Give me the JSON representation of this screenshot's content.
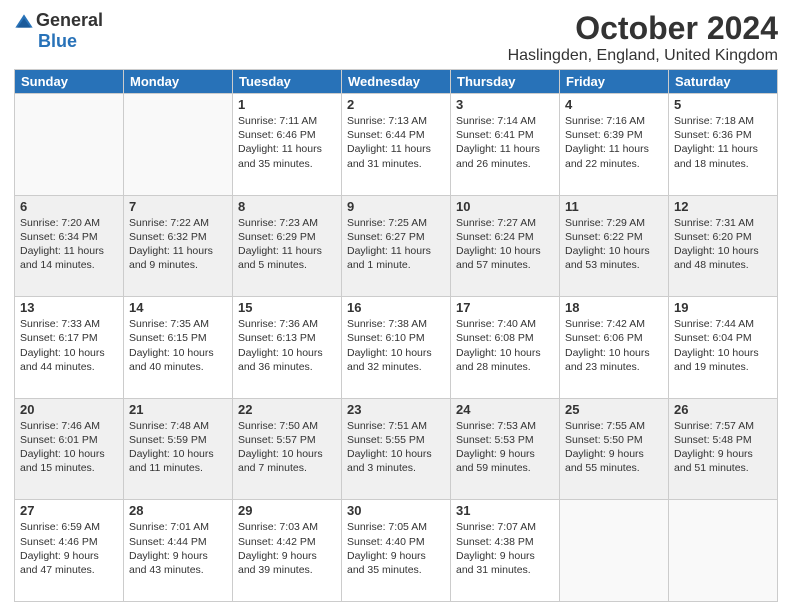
{
  "header": {
    "logo": {
      "general": "General",
      "blue": "Blue",
      "logo_symbol": "▶"
    },
    "title": "October 2024",
    "subtitle": "Haslingden, England, United Kingdom"
  },
  "days_of_week": [
    "Sunday",
    "Monday",
    "Tuesday",
    "Wednesday",
    "Thursday",
    "Friday",
    "Saturday"
  ],
  "weeks": [
    [
      {
        "day": "",
        "info": ""
      },
      {
        "day": "",
        "info": ""
      },
      {
        "day": "1",
        "info": "Sunrise: 7:11 AM\nSunset: 6:46 PM\nDaylight: 11 hours\nand 35 minutes."
      },
      {
        "day": "2",
        "info": "Sunrise: 7:13 AM\nSunset: 6:44 PM\nDaylight: 11 hours\nand 31 minutes."
      },
      {
        "day": "3",
        "info": "Sunrise: 7:14 AM\nSunset: 6:41 PM\nDaylight: 11 hours\nand 26 minutes."
      },
      {
        "day": "4",
        "info": "Sunrise: 7:16 AM\nSunset: 6:39 PM\nDaylight: 11 hours\nand 22 minutes."
      },
      {
        "day": "5",
        "info": "Sunrise: 7:18 AM\nSunset: 6:36 PM\nDaylight: 11 hours\nand 18 minutes."
      }
    ],
    [
      {
        "day": "6",
        "info": "Sunrise: 7:20 AM\nSunset: 6:34 PM\nDaylight: 11 hours\nand 14 minutes."
      },
      {
        "day": "7",
        "info": "Sunrise: 7:22 AM\nSunset: 6:32 PM\nDaylight: 11 hours\nand 9 minutes."
      },
      {
        "day": "8",
        "info": "Sunrise: 7:23 AM\nSunset: 6:29 PM\nDaylight: 11 hours\nand 5 minutes."
      },
      {
        "day": "9",
        "info": "Sunrise: 7:25 AM\nSunset: 6:27 PM\nDaylight: 11 hours\nand 1 minute."
      },
      {
        "day": "10",
        "info": "Sunrise: 7:27 AM\nSunset: 6:24 PM\nDaylight: 10 hours\nand 57 minutes."
      },
      {
        "day": "11",
        "info": "Sunrise: 7:29 AM\nSunset: 6:22 PM\nDaylight: 10 hours\nand 53 minutes."
      },
      {
        "day": "12",
        "info": "Sunrise: 7:31 AM\nSunset: 6:20 PM\nDaylight: 10 hours\nand 48 minutes."
      }
    ],
    [
      {
        "day": "13",
        "info": "Sunrise: 7:33 AM\nSunset: 6:17 PM\nDaylight: 10 hours\nand 44 minutes."
      },
      {
        "day": "14",
        "info": "Sunrise: 7:35 AM\nSunset: 6:15 PM\nDaylight: 10 hours\nand 40 minutes."
      },
      {
        "day": "15",
        "info": "Sunrise: 7:36 AM\nSunset: 6:13 PM\nDaylight: 10 hours\nand 36 minutes."
      },
      {
        "day": "16",
        "info": "Sunrise: 7:38 AM\nSunset: 6:10 PM\nDaylight: 10 hours\nand 32 minutes."
      },
      {
        "day": "17",
        "info": "Sunrise: 7:40 AM\nSunset: 6:08 PM\nDaylight: 10 hours\nand 28 minutes."
      },
      {
        "day": "18",
        "info": "Sunrise: 7:42 AM\nSunset: 6:06 PM\nDaylight: 10 hours\nand 23 minutes."
      },
      {
        "day": "19",
        "info": "Sunrise: 7:44 AM\nSunset: 6:04 PM\nDaylight: 10 hours\nand 19 minutes."
      }
    ],
    [
      {
        "day": "20",
        "info": "Sunrise: 7:46 AM\nSunset: 6:01 PM\nDaylight: 10 hours\nand 15 minutes."
      },
      {
        "day": "21",
        "info": "Sunrise: 7:48 AM\nSunset: 5:59 PM\nDaylight: 10 hours\nand 11 minutes."
      },
      {
        "day": "22",
        "info": "Sunrise: 7:50 AM\nSunset: 5:57 PM\nDaylight: 10 hours\nand 7 minutes."
      },
      {
        "day": "23",
        "info": "Sunrise: 7:51 AM\nSunset: 5:55 PM\nDaylight: 10 hours\nand 3 minutes."
      },
      {
        "day": "24",
        "info": "Sunrise: 7:53 AM\nSunset: 5:53 PM\nDaylight: 9 hours\nand 59 minutes."
      },
      {
        "day": "25",
        "info": "Sunrise: 7:55 AM\nSunset: 5:50 PM\nDaylight: 9 hours\nand 55 minutes."
      },
      {
        "day": "26",
        "info": "Sunrise: 7:57 AM\nSunset: 5:48 PM\nDaylight: 9 hours\nand 51 minutes."
      }
    ],
    [
      {
        "day": "27",
        "info": "Sunrise: 6:59 AM\nSunset: 4:46 PM\nDaylight: 9 hours\nand 47 minutes."
      },
      {
        "day": "28",
        "info": "Sunrise: 7:01 AM\nSunset: 4:44 PM\nDaylight: 9 hours\nand 43 minutes."
      },
      {
        "day": "29",
        "info": "Sunrise: 7:03 AM\nSunset: 4:42 PM\nDaylight: 9 hours\nand 39 minutes."
      },
      {
        "day": "30",
        "info": "Sunrise: 7:05 AM\nSunset: 4:40 PM\nDaylight: 9 hours\nand 35 minutes."
      },
      {
        "day": "31",
        "info": "Sunrise: 7:07 AM\nSunset: 4:38 PM\nDaylight: 9 hours\nand 31 minutes."
      },
      {
        "day": "",
        "info": ""
      },
      {
        "day": "",
        "info": ""
      }
    ]
  ]
}
